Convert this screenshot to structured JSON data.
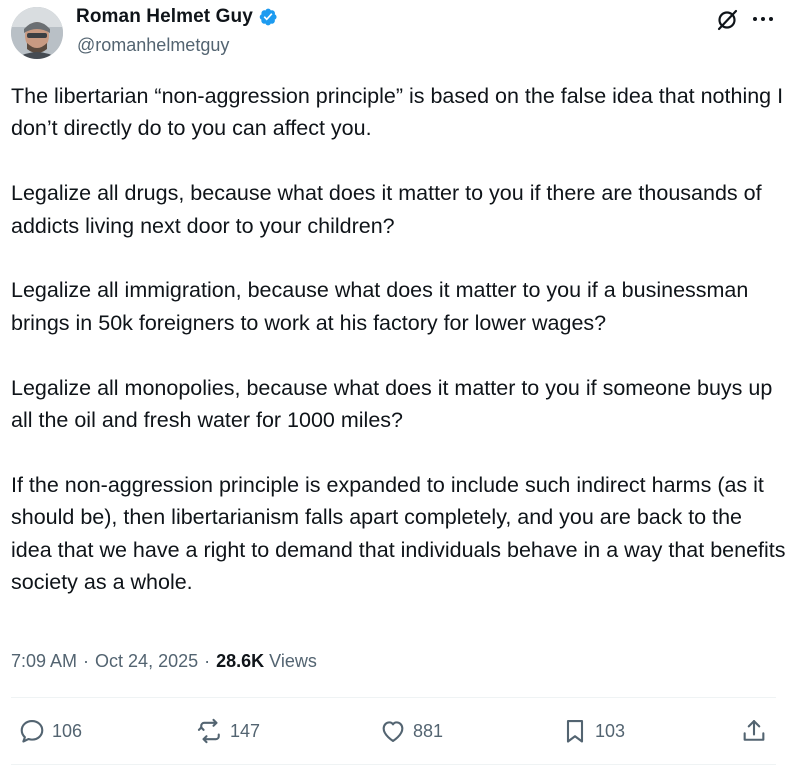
{
  "author": {
    "display_name": "Roman Helmet Guy",
    "handle": "@romanhelmetguy",
    "verified": true,
    "verified_color": "#1d9bf0"
  },
  "tweet": {
    "paragraphs": [
      "The libertarian “non-aggression principle” is based on the false idea that nothing I don’t directly do to you can affect you.",
      "Legalize all drugs, because what does it matter to you if there are thousands of addicts living next door to your children?",
      "Legalize all immigration, because what does it matter to you if a businessman brings in 50k foreigners to work at his factory for lower wages?",
      "Legalize all monopolies, because what does it matter to you if someone buys up all the oil and fresh water for 1000 miles?",
      "If the non-aggression principle is expanded to include such indirect harms (as it should be), then libertarianism falls apart completely, and you are back to the idea that we have a right to demand that individuals behave in a way that benefits society as a whole."
    ]
  },
  "meta": {
    "time": "7:09 AM",
    "separator": "·",
    "date": "Oct 24, 2025",
    "views_count": "28.6K",
    "views_label": "Views"
  },
  "actions": {
    "replies": "106",
    "reposts": "147",
    "likes": "881",
    "bookmarks": "103"
  },
  "icons": {
    "grok": "grok-icon",
    "more": "more-icon",
    "reply": "reply-icon",
    "repost": "repost-icon",
    "like": "heart-icon",
    "bookmark": "bookmark-icon",
    "share": "share-icon"
  },
  "colors": {
    "text_primary": "#0f1419",
    "text_secondary": "#536471",
    "divider": "#eff3f4",
    "accent": "#1d9bf0"
  }
}
